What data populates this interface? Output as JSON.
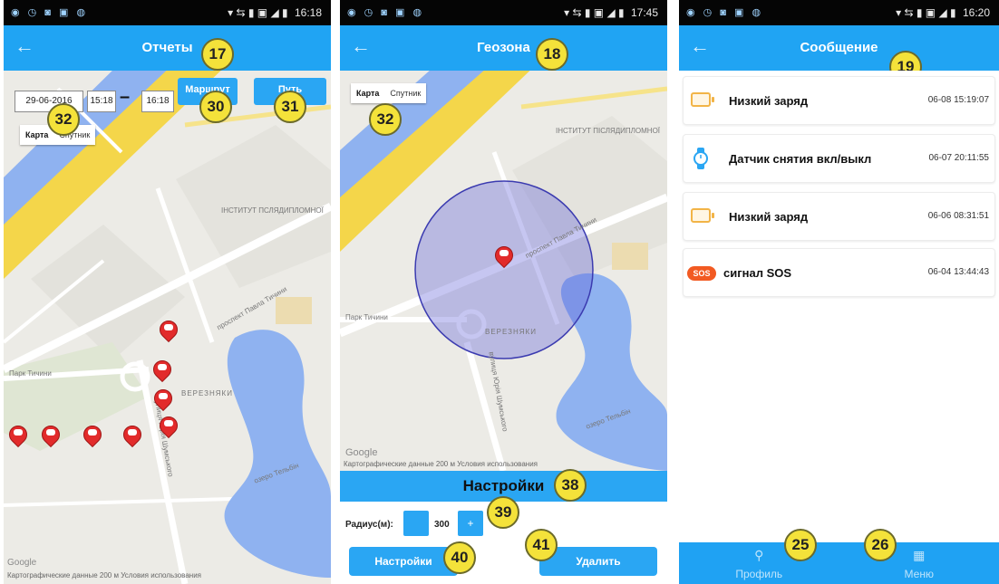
{
  "colors": {
    "accent": "#20a4f3",
    "pin": "#e22b2b",
    "badge": "#f4e23a",
    "geofence": "#5b5bd6"
  },
  "panel1": {
    "status": {
      "icons": "◉ ◷ ◙ ▣ ◍",
      "right": "▾ ⇆ ▮ ▣ ◢ ▮",
      "time": "16:18"
    },
    "title": "Отчеты",
    "back_icon": "←",
    "date_value": "29-06-2016",
    "time_from": "15:18",
    "time_dash": "–",
    "time_to": "16:18",
    "route_label": "Маршрут",
    "path_label": "Путь",
    "map_types": [
      "Карта",
      "Спутник"
    ],
    "map_labels": [
      "ІНСТИТУТ ПСЛЯДИПЛОМНОЇ",
      "Парк Тичини",
      "проспект Павла Тичини",
      "озеро Тельбін",
      "вулиця Юрія Шумського",
      "ВЕРЕЗНЯКИ"
    ],
    "attribution": "Картографические данные    200 м            Условия использования",
    "google": "Google",
    "badges": [
      "17",
      "32",
      "30",
      "31"
    ]
  },
  "panel2": {
    "status": {
      "icons": "◉ ◷ ◙ ▣ ◍",
      "right": "▾ ⇆ ▮ ▣ ◢ ▮",
      "time": "17:45"
    },
    "title": "Геозона",
    "back_icon": "←",
    "map_types": [
      "Карта",
      "Спутник"
    ],
    "map_labels": [
      "ІНСТИТУТ ПІСЛЯДИПЛОМНОЇ",
      "Парк Тичини",
      "проспект Павла Тичини",
      "озеро Тельбін",
      "вулиця Юрія Шумського",
      "ВЕРЕЗНЯКИ"
    ],
    "attribution": "Картографические данные    200 м            Условия использования",
    "google": "Google",
    "settings_title": "Настройки",
    "radius_label": "Радиус(м):",
    "radius_value": "300",
    "minus_label": "",
    "plus_label": "+",
    "settings_button": "Настройки",
    "delete_button": "Удалить",
    "badges": [
      "18",
      "32",
      "38",
      "39",
      "40",
      "41"
    ]
  },
  "panel3": {
    "status": {
      "icons": "◉ ◷ ◙ ▣ ◍",
      "right": "▾ ⇆ ▮ ▣ ◢ ▮",
      "time": "16:20"
    },
    "title": "Сообщение",
    "back_icon": "←",
    "messages": [
      {
        "icon": "battery-icon",
        "text": "Низкий заряд",
        "time": "06-08 15:19:07"
      },
      {
        "icon": "watch-icon",
        "text": "Датчик снятия вкл/выкл",
        "time": "06-07 20:11:55"
      },
      {
        "icon": "battery-icon",
        "text": "Низкий заряд",
        "time": "06-06 08:31:51"
      },
      {
        "icon": "sos-icon",
        "text": "сигнал SOS",
        "time": "06-04 13:44:43",
        "badge": "SOS"
      }
    ],
    "tabs": [
      {
        "label": "Профиль",
        "icon": "profile-icon"
      },
      {
        "label": "Меню",
        "icon": "menu-icon"
      }
    ],
    "badges": [
      "19",
      "25",
      "26"
    ]
  }
}
